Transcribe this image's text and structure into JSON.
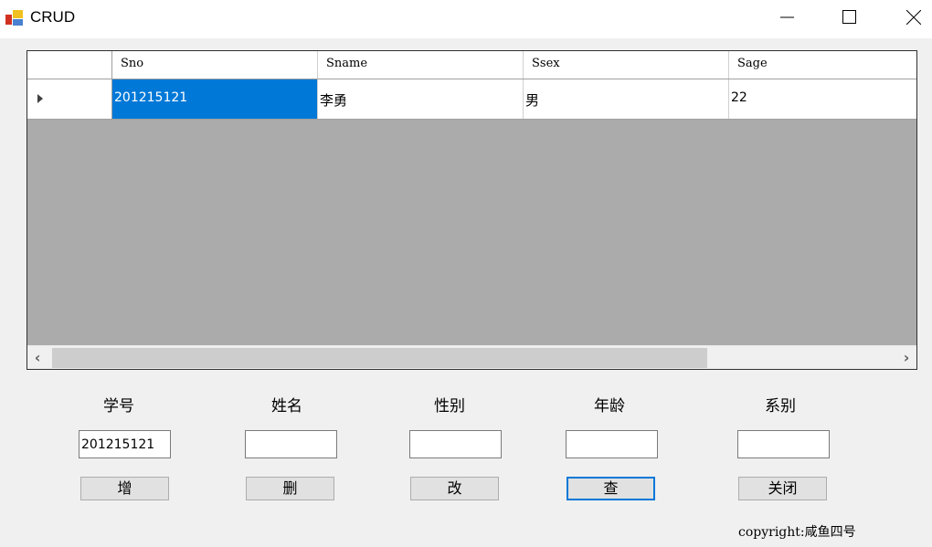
{
  "window": {
    "title": "CRUD",
    "icon": "app-form-icon",
    "controls": [
      "minimize-icon",
      "maximize-icon",
      "close-icon"
    ]
  },
  "grid": {
    "columns": [
      "Sno",
      "Sname",
      "Ssex",
      "Sage"
    ],
    "rows": [
      {
        "current_row_indicator": "triangle-right-icon",
        "cells": [
          "201215121",
          "李勇",
          "男",
          "22"
        ]
      }
    ],
    "selected_cell": "Sno",
    "scrollbar": {
      "left": "‹",
      "right": "›"
    }
  },
  "form": {
    "labels": [
      "学号",
      "姓名",
      "性别",
      "年龄",
      "系别"
    ],
    "inputs": [
      {
        "name": "sno",
        "value": "201215121"
      },
      {
        "name": "sname",
        "value": ""
      },
      {
        "name": "ssex",
        "value": ""
      },
      {
        "name": "sage",
        "value": ""
      },
      {
        "name": "sdept",
        "value": ""
      }
    ],
    "buttons": [
      "增",
      "删",
      "改",
      "查",
      "关闭"
    ],
    "focused_button": "查"
  },
  "footer": {
    "copyright": "copyright:咸鱼四号"
  }
}
